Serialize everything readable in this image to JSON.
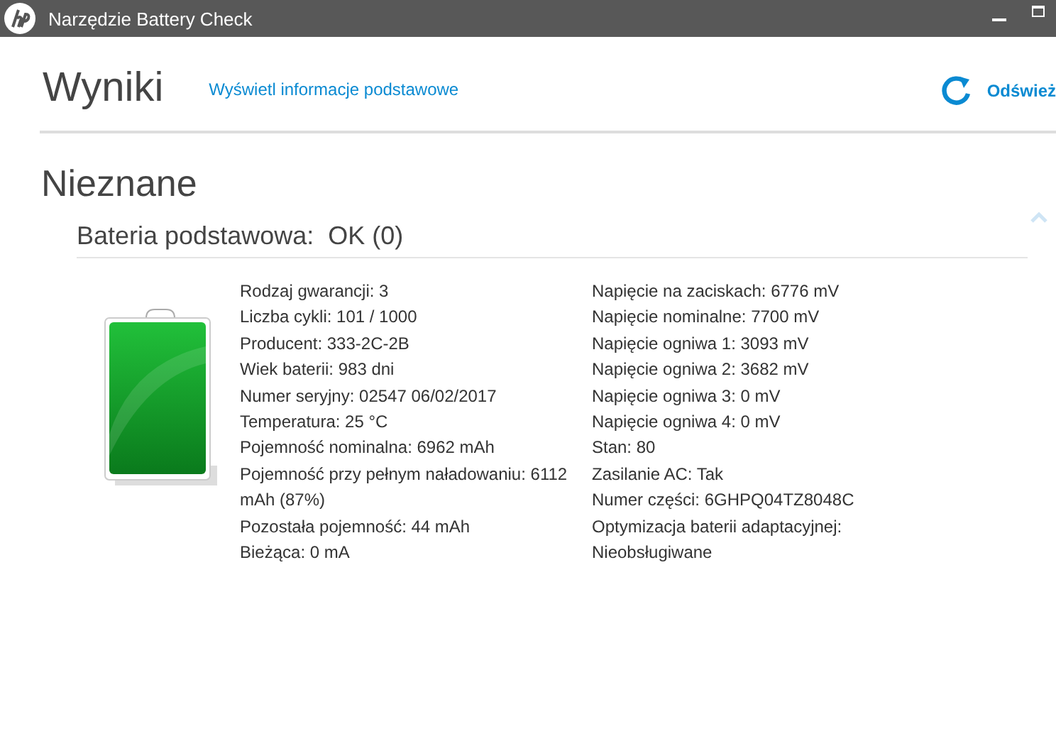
{
  "window": {
    "title": "Narzędzie Battery Check"
  },
  "header": {
    "title": "Wyniki",
    "link": "Wyświetl informacje podstawowe",
    "refresh": "Odśwież"
  },
  "status": "Nieznane",
  "battery": {
    "heading": "Bateria podstawowa:  OK (0)",
    "left": [
      "Rodzaj gwarancji: 3",
      "Liczba cykli: 101 / 1000",
      "Producent: 333-2C-2B",
      "Wiek baterii: 983 dni",
      "Numer seryjny: 02547 06/02/2017",
      "Temperatura: 25 °C",
      "Pojemność nominalna: 6962 mAh",
      "Pojemność przy pełnym naładowaniu: 6112 mAh (87%)",
      "Pozostała pojemność: 44 mAh",
      "Bieżąca: 0 mA"
    ],
    "right": [
      "Napięcie na zaciskach: 6776 mV",
      "Napięcie nominalne: 7700 mV",
      "Napięcie ogniwa 1: 3093 mV",
      "Napięcie ogniwa 2: 3682 mV",
      "Napięcie ogniwa 3: 0 mV",
      "Napięcie ogniwa 4: 0 mV",
      "Stan: 80",
      "Zasilanie AC: Tak",
      "Numer części: 6GHPQ04TZ8048C",
      "Optymizacja baterii adaptacyjnej: Nieobsługiwane"
    ]
  }
}
